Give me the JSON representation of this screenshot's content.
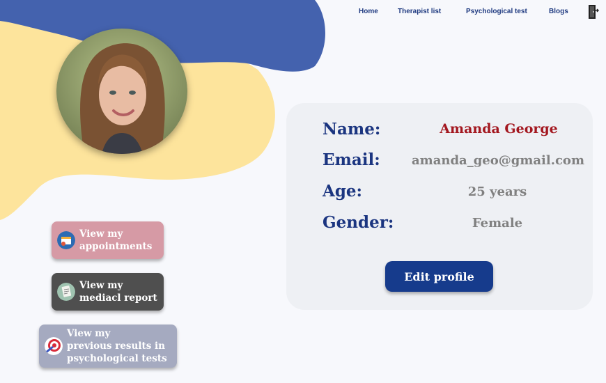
{
  "nav": {
    "items": [
      {
        "label": "Home"
      },
      {
        "label": "Therapist list"
      },
      {
        "label": "Psychological test"
      },
      {
        "label": "Blogs"
      }
    ],
    "logout_icon": "logout-door-icon"
  },
  "profile": {
    "name_label": "Name:",
    "name_value": "Amanda George",
    "email_label": "Email:",
    "email_value": "amanda_geo@gmail.com",
    "age_label": "Age:",
    "age_value": "25 years",
    "gender_label": "Gender:",
    "gender_value": "Female",
    "edit_button": "Edit profile"
  },
  "actions": {
    "appointments": "View my\nappointments",
    "report": "View my\nmediacl report",
    "results": "View my\nprevious results in\npsychological tests"
  },
  "colors": {
    "blob_blue": "#4462ae",
    "blob_yellow": "#fde49c",
    "heading_blue": "#1b3580",
    "name_red": "#a3171f",
    "appointments_bg": "#d69aa5",
    "report_bg": "#4f4f4f",
    "results_bg": "#a5aac0"
  }
}
